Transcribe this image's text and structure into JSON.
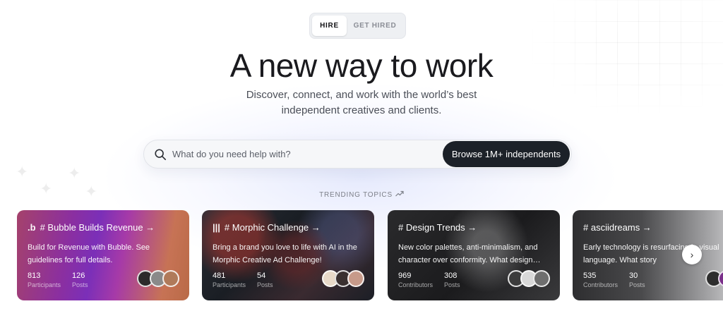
{
  "toggle": {
    "hire": "HIRE",
    "get_hired": "GET HIRED"
  },
  "hero": {
    "title": "A new way to work",
    "subtitle": "Discover, connect, and work with the world’s best independent creatives and clients."
  },
  "search": {
    "placeholder": "What do you need help with?",
    "cta": "Browse 1M+ independents"
  },
  "trending": {
    "label": "TRENDING TOPICS",
    "icon": "trend-up-icon"
  },
  "cards": [
    {
      "logo": ".b",
      "title": "# Bubble Builds Revenue →",
      "desc": "Build for Revenue with Bubble. See guidelines for full details.",
      "stat1_num": "813",
      "stat1_label": "Participants",
      "stat2_num": "126",
      "stat2_label": "Posts"
    },
    {
      "logo": "|||",
      "title": "# Morphic Challenge →",
      "desc": "Bring a brand you love to life with AI in the Morphic Creative Ad Challenge!",
      "stat1_num": "481",
      "stat1_label": "Participants",
      "stat2_num": "54",
      "stat2_label": "Posts"
    },
    {
      "logo": "",
      "title": "# Design Trends →",
      "desc": "New color palettes, anti-minimalism, and character over conformity. What design…",
      "stat1_num": "969",
      "stat1_label": "Contributors",
      "stat2_num": "308",
      "stat2_label": "Posts"
    },
    {
      "logo": "",
      "title": "# asciidreams →",
      "desc": "Early technology is resurfacing in visual language. What story",
      "stat1_num": "535",
      "stat1_label": "Contributors",
      "stat2_num": "30",
      "stat2_label": "Posts"
    }
  ],
  "carousel": {
    "next": "›"
  }
}
